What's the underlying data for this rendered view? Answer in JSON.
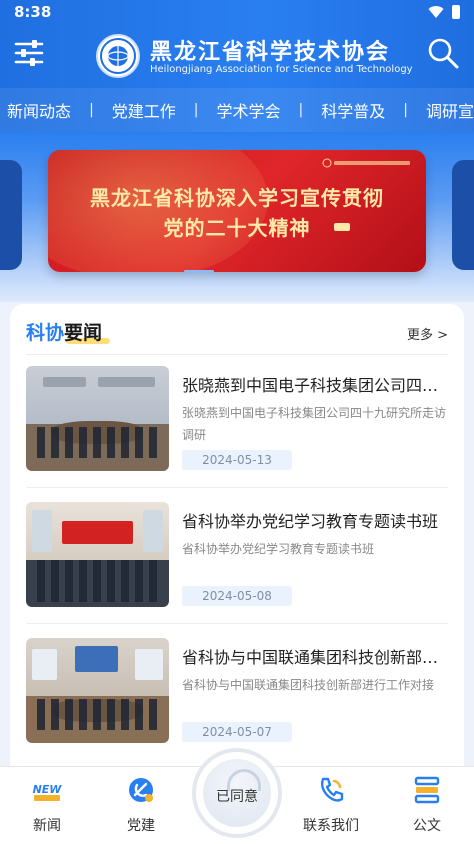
{
  "status_bar": {
    "time": "8:38"
  },
  "header": {
    "title_cn": "黑龙江省科学技术协会",
    "title_en": "Heilongjiang Association for Science and Technology",
    "menu_icon": "sliders-menu-icon",
    "search_icon": "search-icon",
    "accent_color": "#2a7ff0"
  },
  "nav": {
    "items": [
      {
        "label": "新闻动态"
      },
      {
        "label": "党建工作"
      },
      {
        "label": "学术学会"
      },
      {
        "label": "科学普及"
      },
      {
        "label": "调研宣"
      }
    ],
    "separator": "|"
  },
  "banner": {
    "line1": "黑龙江省科协深入学习宣传贯彻",
    "line2": "党的二十大精神",
    "color": "#d71f26"
  },
  "news": {
    "title_part1": "科协",
    "title_part2": "要闻",
    "more_label": "更多 >",
    "items": [
      {
        "title": "张晓燕到中国电子科技集团公司四十九研究所走访调研",
        "desc": "张晓燕到中国电子科技集团公司四十九研究所走访调研",
        "date": "2024-05-13"
      },
      {
        "title": "省科协举办党纪学习教育专题读书班",
        "desc": "省科协举办党纪学习教育专题读书班",
        "date": "2024-05-08"
      },
      {
        "title": "省科协与中国联通集团科技创新部进行工作对接",
        "desc": "省科协与中国联通集团科技创新部进行工作对接",
        "date": "2024-05-07"
      }
    ]
  },
  "tabbar": {
    "tabs": [
      {
        "label": "新闻",
        "icon": "news-icon"
      },
      {
        "label": "党建",
        "icon": "party-emblem-icon"
      },
      {
        "label": "联系我们",
        "icon": "phone-icon"
      },
      {
        "label": "公文",
        "icon": "document-stack-icon"
      }
    ],
    "center_label": "已同意"
  }
}
